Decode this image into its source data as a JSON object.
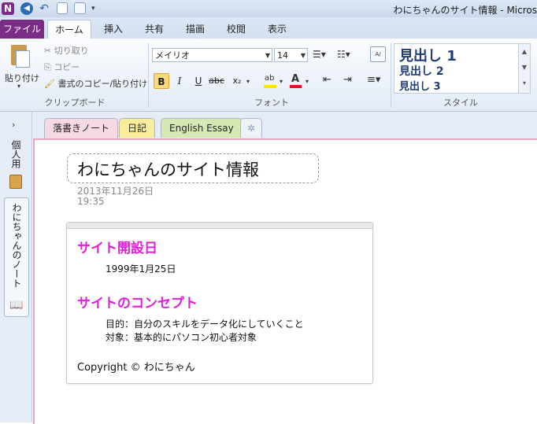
{
  "window": {
    "title": "わにちゃんのサイト情報 - Micros"
  },
  "ribbon_tabs": [
    "ファイル",
    "ホーム",
    "挿入",
    "共有",
    "描画",
    "校閲",
    "表示"
  ],
  "clipboard": {
    "paste": "貼り付け",
    "cut": "切り取り",
    "copy": "コピー",
    "format_painter": "書式のコピー/貼り付け",
    "group_label": "クリップボード"
  },
  "font": {
    "font_name": "メイリオ",
    "font_size": "14",
    "group_label": "フォント",
    "bold": "B",
    "italic": "I",
    "underline": "U",
    "strike": "abc",
    "subscript": "x₂"
  },
  "styles": {
    "items": [
      "見出し 1",
      "見出し 2",
      "見出し 3"
    ],
    "group_label": "スタイル"
  },
  "left_nav": {
    "personal": "個人用",
    "notebook": "わにちゃんのノート"
  },
  "section_tabs": [
    "落書きノート",
    "日記",
    "English Essay"
  ],
  "page": {
    "title": "わにちゃんのサイト情報",
    "date": "2013年11月26日",
    "time": "19:35"
  },
  "note": {
    "heading1": "サイト開設日",
    "date_line": "1999年1月25日",
    "heading2": "サイトのコンセプト",
    "purpose": "目的：自分のスキルをデータ化にしていくこと",
    "target": "対象：基本的にパソコン初心者対象",
    "copyright": "Copyright © わにちゃん"
  },
  "colors": {
    "file_tab": "#7b2c87",
    "heading_text": "#e020d8",
    "section_active": "#f7d9e6",
    "section_diary": "#f9ec9a",
    "section_essay": "#d6e9b5"
  }
}
